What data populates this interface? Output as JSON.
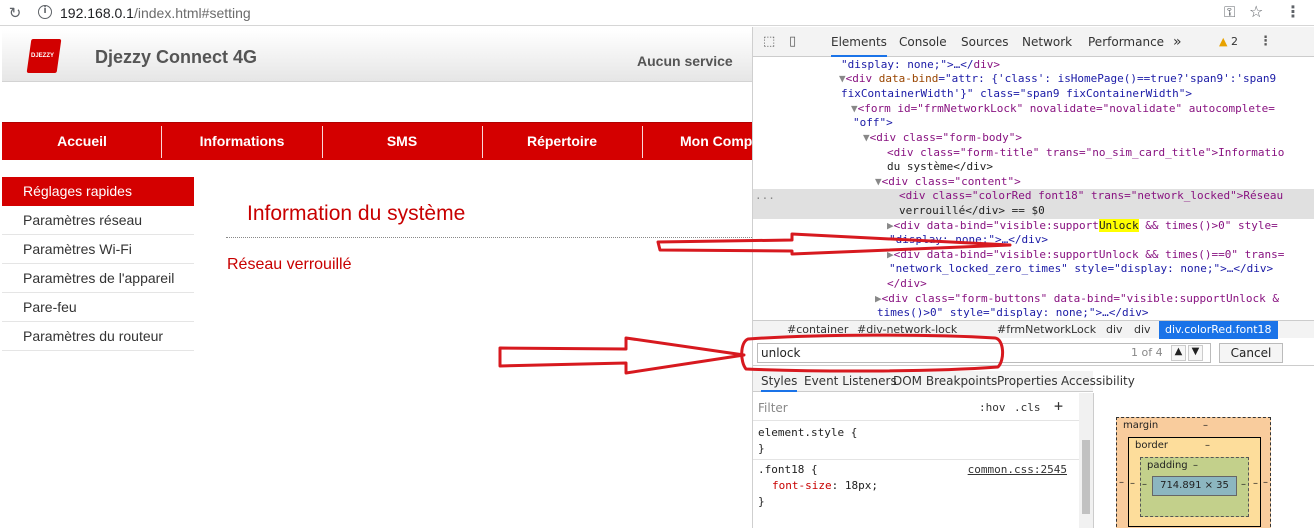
{
  "browser": {
    "url_host": "192.168.0.1",
    "url_path": "/index.html#setting"
  },
  "router": {
    "logo_text": "DJEZZY",
    "brand": "Djezzy Connect 4G",
    "service_status": "Aucun service",
    "nav": [
      "Accueil",
      "Informations",
      "SMS",
      "Répertoire",
      "Mon Comp"
    ],
    "sidebar": [
      "Réglages rapides",
      "Paramètres réseau",
      "Paramètres Wi-Fi",
      "Paramètres de l'appareil",
      "Pare-feu",
      "Paramètres du routeur"
    ],
    "section_title": "Information du système",
    "status_text": "Réseau verrouillé"
  },
  "devtools": {
    "tabs": [
      "Elements",
      "Console",
      "Sources",
      "Network",
      "Performance"
    ],
    "more_tabs": "»",
    "warning_count": "2",
    "code_lines": [
      {
        "pre": "\"display: none;\">…</",
        "tag": "div",
        "post": ">"
      },
      {
        "open": "<div ",
        "attr1": "data-bind",
        "eq1": "=\"attr: {'class': isHomePage()==true?'span9':'span9",
        "rest": ""
      },
      {
        "text": "fixContainerWidth'}\" class=\"span9 fixContainerWidth\">"
      },
      {
        "text": "<form id=\"frmNetworkLock\" novalidate=\"novalidate\" autocomplete="
      },
      {
        "text": "\"off\">"
      },
      {
        "text": "<div class=\"form-body\">"
      },
      {
        "text": "<div class=\"form-title\" trans=\"no_sim_card_title\">Informatio"
      },
      {
        "text": "du système</div>"
      },
      {
        "text": "<div class=\"content\">"
      },
      {
        "text": "<div class=\"colorRed font18\" trans=\"network_locked\">Réseau"
      },
      {
        "text": "verrouillé</div> == $0"
      },
      {
        "pre": "<div data-bind=\"visible:support",
        "hl": "Unlock",
        "post": " && times()>0\" style="
      },
      {
        "text": "\"display: none;\">…</div>"
      },
      {
        "text": "<div data-bind=\"visible:supportUnlock && times()==0\" trans="
      },
      {
        "text": "\"network_locked_zero_times\" style=\"display: none;\">…</div>"
      },
      {
        "text": "</div>"
      },
      {
        "text": "<div class=\"form-buttons\" data-bind=\"visible:supportUnlock &"
      },
      {
        "text": "times()>0\" style=\"display: none;\">…</div>"
      }
    ],
    "selected_marker": "...",
    "breadcrumbs": [
      "#container",
      "#div-network-lock",
      "#frmNetworkLock",
      "div",
      "div",
      "div.colorRed.font18"
    ],
    "search_value": "unlock",
    "search_count": "1 of 4",
    "cancel_label": "Cancel",
    "sub_tabs": [
      "Styles",
      "Event Listeners",
      "DOM Breakpoints",
      "Properties",
      "Accessibility"
    ],
    "filter_placeholder": "Filter",
    "hov_label": ":hov",
    "cls_label": ".cls",
    "style_rules": {
      "element_style": "element.style {",
      "close": "}",
      "selector": ".font18 {",
      "source": "common.css:2545",
      "prop": "font-size",
      "value": "18px;",
      "next": "}"
    },
    "box_model": {
      "margin": "margin",
      "border": "border",
      "padding": "padding",
      "dash": "–",
      "content": "714.891 × 35"
    }
  },
  "colors": {
    "brand_red": "#d40000",
    "annotation_red": "#d7191f",
    "devtools_accent": "#1a73e8"
  }
}
